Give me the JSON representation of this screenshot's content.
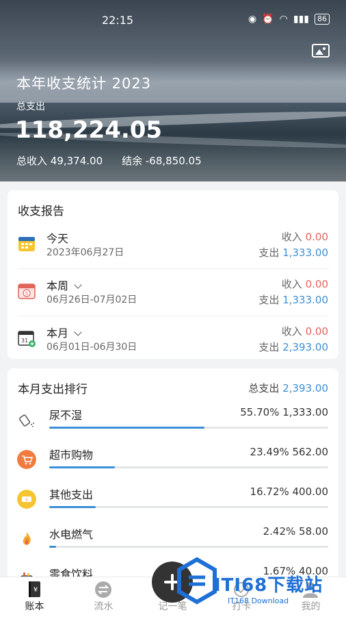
{
  "status_bar": {
    "time": "22:15",
    "battery": "86"
  },
  "header": {
    "title": "本年收支统计 2023",
    "subtitle": "总支出",
    "total": "118,224.05",
    "income_label": "总收入 49,374.00",
    "balance_label": "结余 -68,850.05"
  },
  "report": {
    "title": "收支报告",
    "income_prefix": "收入",
    "expense_prefix": "支出",
    "rows": [
      {
        "label": "今天",
        "date": "2023年06月27日",
        "income": "0.00",
        "expense": "1,333.00"
      },
      {
        "label": "本周",
        "date": "06月26日-07月02日",
        "income": "0.00",
        "expense": "1,333.00"
      },
      {
        "label": "本月",
        "date": "06月01日-06月30日",
        "income": "0.00",
        "expense": "2,393.00"
      }
    ]
  },
  "ranking": {
    "title": "本月支出排行",
    "total_label": "总支出",
    "total_value": "2,393.00",
    "items": [
      {
        "name": "尿不湿",
        "value": "55.70% 1,333.00",
        "percent": 55.7,
        "icon": "diaper-icon",
        "color": "#ffffff"
      },
      {
        "name": "超市购物",
        "value": "23.49% 562.00",
        "percent": 23.49,
        "icon": "cart-icon",
        "color": "#f07b3f"
      },
      {
        "name": "其他支出",
        "value": "16.72% 400.00",
        "percent": 16.72,
        "icon": "tag-icon",
        "color": "#f5c531"
      },
      {
        "name": "水电燃气",
        "value": "2.42% 58.00",
        "percent": 2.42,
        "icon": "flame-icon",
        "color": "#ffffff"
      },
      {
        "name": "零食饮料",
        "value": "1.67% 40.00",
        "percent": 1.67,
        "icon": "snack-icon",
        "color": "#ffffff"
      }
    ]
  },
  "nav": [
    {
      "label": "账本",
      "icon": "ledger-icon",
      "active": true
    },
    {
      "label": "流水",
      "icon": "exchange-icon",
      "active": false
    },
    {
      "label": "记一笔",
      "icon": "add-icon",
      "active": false
    },
    {
      "label": "打卡",
      "icon": "checkin-icon",
      "active": false
    },
    {
      "label": "我的",
      "icon": "user-icon",
      "active": false
    }
  ],
  "watermark": {
    "text": "ITI68下载站",
    "sub": "IT168 Download"
  }
}
